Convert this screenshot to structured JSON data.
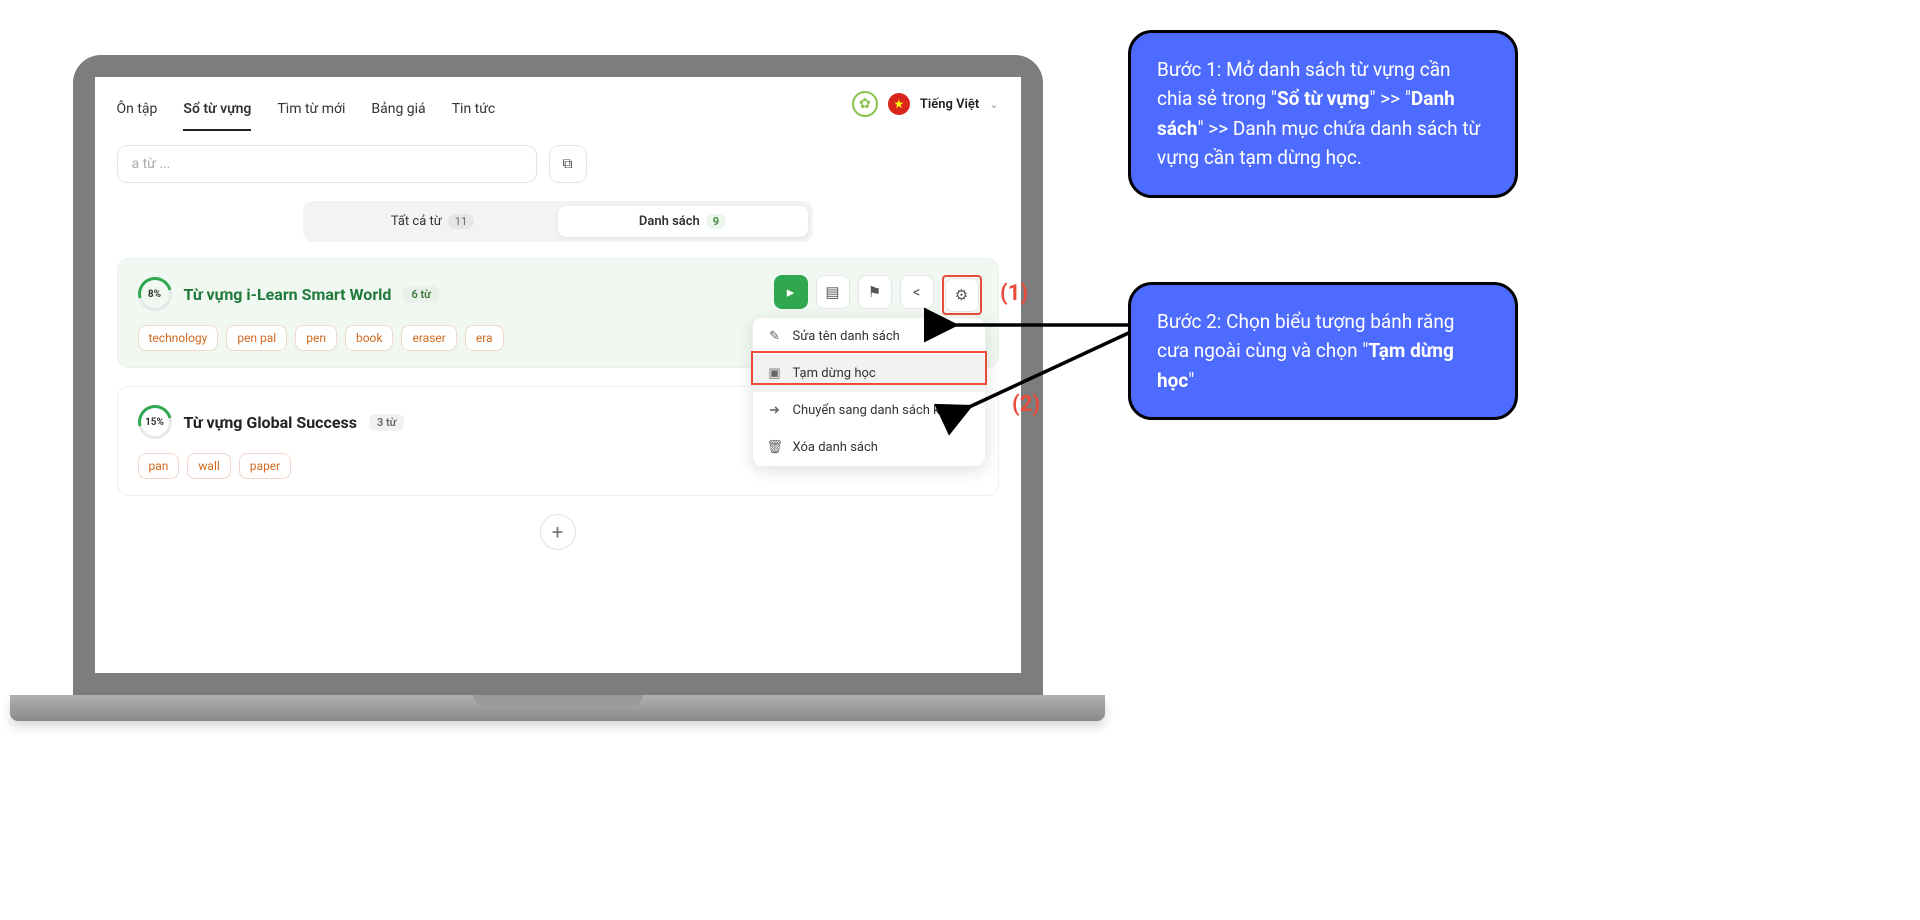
{
  "nav": {
    "items": [
      "Ôn tập",
      "Sổ từ vựng",
      "Tìm từ mới",
      "Bảng giá",
      "Tin tức"
    ],
    "active": 1,
    "language": "Tiếng Việt"
  },
  "search": {
    "placeholder": "a từ ..."
  },
  "tabs": {
    "all_label": "Tất cả từ",
    "all_count": "11",
    "list_label": "Danh sách",
    "list_count": "9"
  },
  "lists": [
    {
      "percent": "8%",
      "title": "Từ vựng i-Learn Smart World",
      "count": "6 từ",
      "tags": [
        "technology",
        "pen pal",
        "pen",
        "book",
        "eraser",
        "era"
      ]
    },
    {
      "percent": "15%",
      "title": "Từ vựng Global Success",
      "count": "3 từ",
      "tags": [
        "pan",
        "wall",
        "paper"
      ]
    }
  ],
  "menu": {
    "rename": "Sửa tên danh sách",
    "pause": "Tạm dừng học",
    "move": "Chuyển sang danh sách khác",
    "delete": "Xóa danh sách"
  },
  "steps": {
    "label1": "(1)",
    "label2": "(2)"
  },
  "bubble1": {
    "pre": "Bước 1: Mở danh sách từ vựng cần chia sẻ trong \"",
    "b1": "Sổ từ vựng",
    "mid1": "\" >> \"",
    "b2": "Danh sách",
    "mid2": "\" >> Danh mục chứa danh sách từ vựng cần tạm dừng học."
  },
  "bubble2": {
    "pre": "Bước 2: Chọn biểu tượng bánh răng cưa ngoài cùng và chọn \"",
    "b": "Tạm dừng học",
    "post": "\""
  }
}
